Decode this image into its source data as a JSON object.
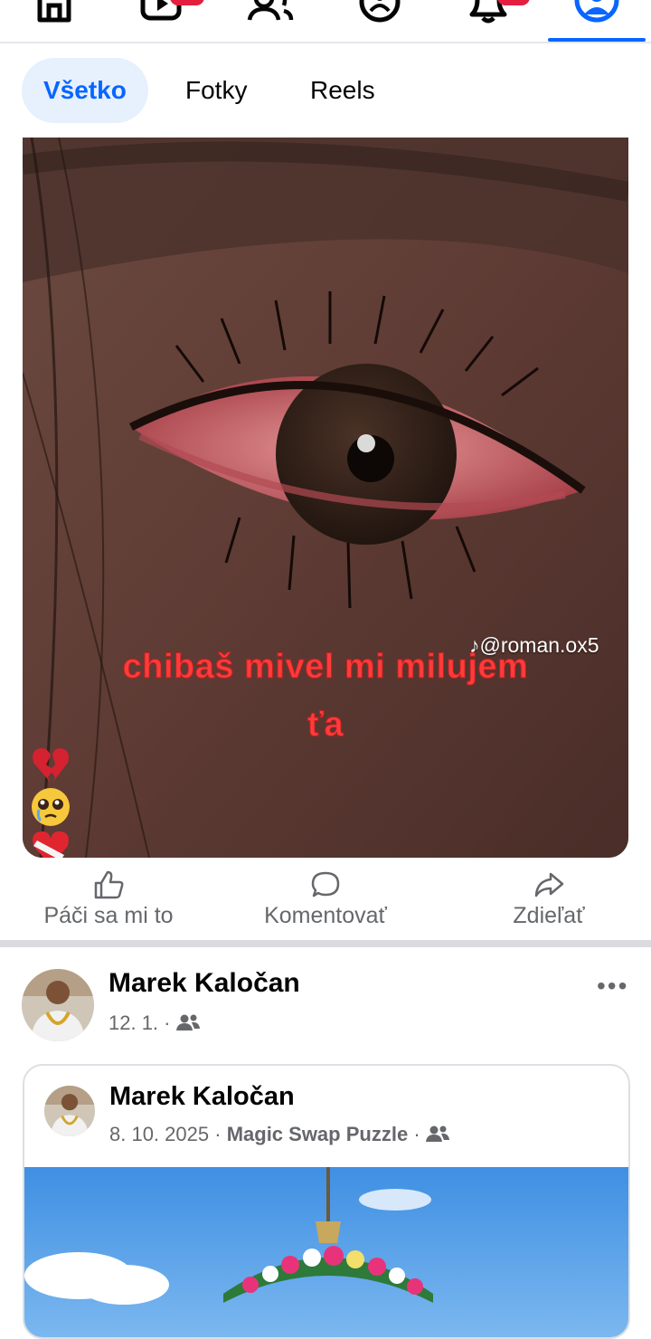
{
  "nav": {
    "items": [
      {
        "icon": "home-icon"
      },
      {
        "icon": "video-icon",
        "badge": true
      },
      {
        "icon": "friends-icon"
      },
      {
        "icon": "groups-icon"
      },
      {
        "icon": "bell-icon",
        "badge": true
      },
      {
        "icon": "profile-icon",
        "active": true
      }
    ],
    "accent": "#0866ff",
    "badge_color": "#e41e3f"
  },
  "filters": {
    "all": "Všetko",
    "photos": "Fotky",
    "reels": "Reels"
  },
  "post1": {
    "watermark": "@roman.ox5",
    "caption_line1": "chibaš mivel mi milujem",
    "caption_line2": "ťa",
    "caption_emojis": [
      "broken-heart-emoji",
      "pleading-face-emoji",
      "bandaged-heart-emoji"
    ],
    "actions": {
      "like": "Páči sa mi to",
      "comment": "Komentovať",
      "share": "Zdieľať"
    }
  },
  "post2": {
    "author": "Marek Kaločan",
    "date": "12. 1.",
    "separator": "·",
    "audience_icon": "friends-audience-icon",
    "shared": {
      "author": "Marek Kaločan",
      "date": "8. 10. 2025",
      "separator": "·",
      "app": "Magic Swap Puzzle",
      "audience_icon": "friends-audience-icon"
    }
  }
}
